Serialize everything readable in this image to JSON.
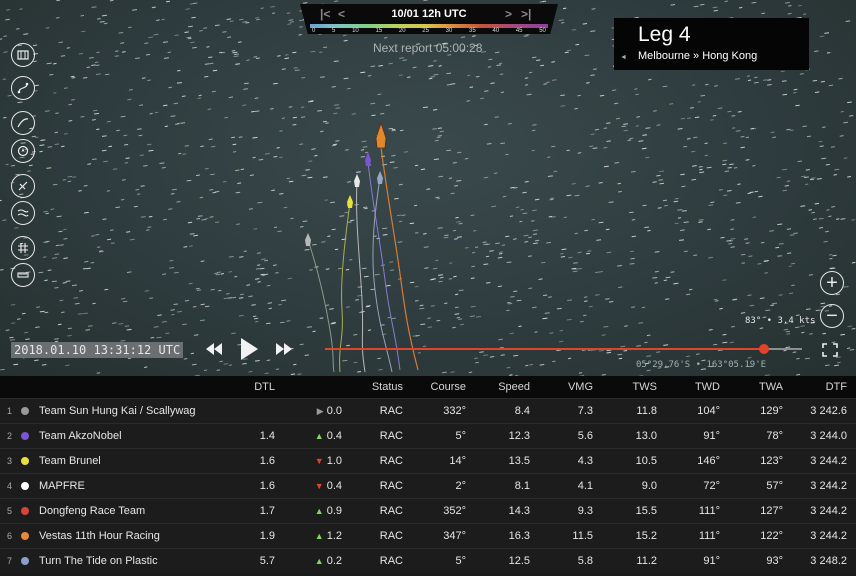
{
  "colors": {
    "accent_orange": "#e0442a",
    "up_green": "#7ed957",
    "down_red": "#e0442a",
    "neutral": "#9a9a9a"
  },
  "timebar": {
    "date": "10/01 12h UTC",
    "first_icon": "skip-back-icon",
    "prev_icon": "step-back-icon",
    "next_icon": "step-forward-icon",
    "last_icon": "skip-forward-icon",
    "scale_labels": [
      "0",
      "5",
      "10",
      "15",
      "20",
      "25",
      "30",
      "35",
      "40",
      "45",
      "50"
    ],
    "next_report": "Next report 05:00:28"
  },
  "leg": {
    "title": "Leg 4",
    "route": "Melbourne » Hong Kong"
  },
  "map": {
    "wind_readout": "83° • 3.4 kts",
    "coords": "05°29.76'S • 163°05.19'E",
    "timestamp": "2018.01.10 13:31:12 UTC",
    "timeline_progress": 0.92
  },
  "toolbar": [
    "map-layers-icon",
    "route-icon",
    "wind-icon",
    "compass-icon",
    "sail-icon",
    "current-icon",
    "grid-icon",
    "ruler-icon"
  ],
  "table": {
    "headers": {
      "dtl": "DTL",
      "status": "Status",
      "course": "Course",
      "speed": "Speed",
      "vmg": "VMG",
      "tws": "TWS",
      "twd": "TWD",
      "twa": "TWA",
      "dtf": "DTF"
    },
    "rows": [
      {
        "rank": "1",
        "team": "Team Sun Hung Kai / Scallywag",
        "color": "#9a9a9a",
        "dtl": "",
        "trend": "neutral",
        "change": "0.0",
        "status": "RAC",
        "course": "332°",
        "speed": "8.4",
        "vmg": "7.3",
        "tws": "11.8",
        "twd": "104°",
        "twa": "129°",
        "dtf": "3 242.6"
      },
      {
        "rank": "2",
        "team": "Team AkzoNobel",
        "color": "#7b55d6",
        "dtl": "1.4",
        "trend": "up",
        "change": "0.4",
        "status": "RAC",
        "course": "5°",
        "speed": "12.3",
        "vmg": "5.6",
        "tws": "13.0",
        "twd": "91°",
        "twa": "78°",
        "dtf": "3 244.0"
      },
      {
        "rank": "3",
        "team": "Team Brunel",
        "color": "#e8e03a",
        "dtl": "1.6",
        "trend": "down",
        "change": "1.0",
        "status": "RAC",
        "course": "14°",
        "speed": "13.5",
        "vmg": "4.3",
        "tws": "10.5",
        "twd": "146°",
        "twa": "123°",
        "dtf": "3 244.2"
      },
      {
        "rank": "4",
        "team": "MAPFRE",
        "color": "#ffffff",
        "dtl": "1.6",
        "trend": "down",
        "change": "0.4",
        "status": "RAC",
        "course": "2°",
        "speed": "8.1",
        "vmg": "4.1",
        "tws": "9.0",
        "twd": "72°",
        "twa": "57°",
        "dtf": "3 244.2"
      },
      {
        "rank": "5",
        "team": "Dongfeng Race Team",
        "color": "#d6453a",
        "dtl": "1.7",
        "trend": "up",
        "change": "0.9",
        "status": "RAC",
        "course": "352°",
        "speed": "14.3",
        "vmg": "9.3",
        "tws": "15.5",
        "twd": "111°",
        "twa": "127°",
        "dtf": "3 244.2"
      },
      {
        "rank": "6",
        "team": "Vestas 11th Hour Racing",
        "color": "#e8883a",
        "dtl": "1.9",
        "trend": "up",
        "change": "1.2",
        "status": "RAC",
        "course": "347°",
        "speed": "16.3",
        "vmg": "11.5",
        "tws": "15.2",
        "twd": "111°",
        "twa": "122°",
        "dtf": "3 244.2"
      },
      {
        "rank": "7",
        "team": "Turn The Tide on Plastic",
        "color": "#8aa0c8",
        "dtl": "5.7",
        "trend": "up",
        "change": "0.2",
        "status": "RAC",
        "course": "5°",
        "speed": "12.5",
        "vmg": "5.8",
        "tws": "11.2",
        "twd": "91°",
        "twa": "93°",
        "dtf": "3 248.2"
      }
    ]
  }
}
